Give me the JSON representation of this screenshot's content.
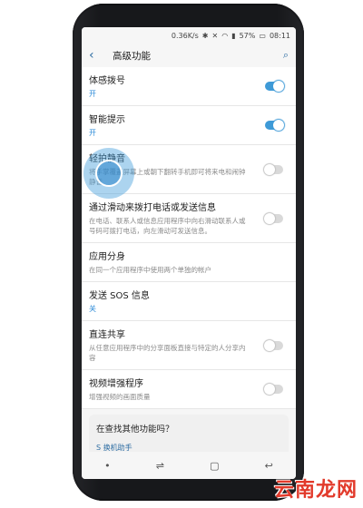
{
  "status": {
    "speed": "0.36K/s",
    "battery": "57%",
    "time": "08:11"
  },
  "header": {
    "title": "高级功能"
  },
  "items": [
    {
      "title": "体感拨号",
      "subtitle": "开",
      "toggle": "on"
    },
    {
      "title": "智能提示",
      "subtitle": "开",
      "toggle": "on"
    },
    {
      "title": "轻拍静音",
      "subtitle": "将手掌覆盖屏幕上或朝下翻转手机即可将来电和闹钟静音",
      "toggle": "off"
    },
    {
      "title": "通过滑动来拨打电话或发送信息",
      "subtitle": "在电话、联系人或信息应用程序中向右滑动联系人或号码可拨打电话，向左滑动可发送信息。",
      "toggle": "off"
    },
    {
      "title": "应用分身",
      "subtitle": "在同一个应用程序中使用两个单独的帐户",
      "toggle": ""
    },
    {
      "title": "发送 SOS 信息",
      "subtitle": "关",
      "toggle": ""
    },
    {
      "title": "直连共享",
      "subtitle": "从任意应用程序中的分享面板直接与特定的人分享内容",
      "toggle": "off"
    },
    {
      "title": "视频增强程序",
      "subtitle": "增强视频的画面质量",
      "toggle": "off"
    }
  ],
  "card": {
    "title": "在查找其他功能吗？",
    "link": "S 换机助手"
  },
  "watermark": "云南龙网",
  "colors": {
    "accent": "#3e9ad7",
    "link": "#2f6ea3",
    "watermark": "#e23a2b"
  }
}
